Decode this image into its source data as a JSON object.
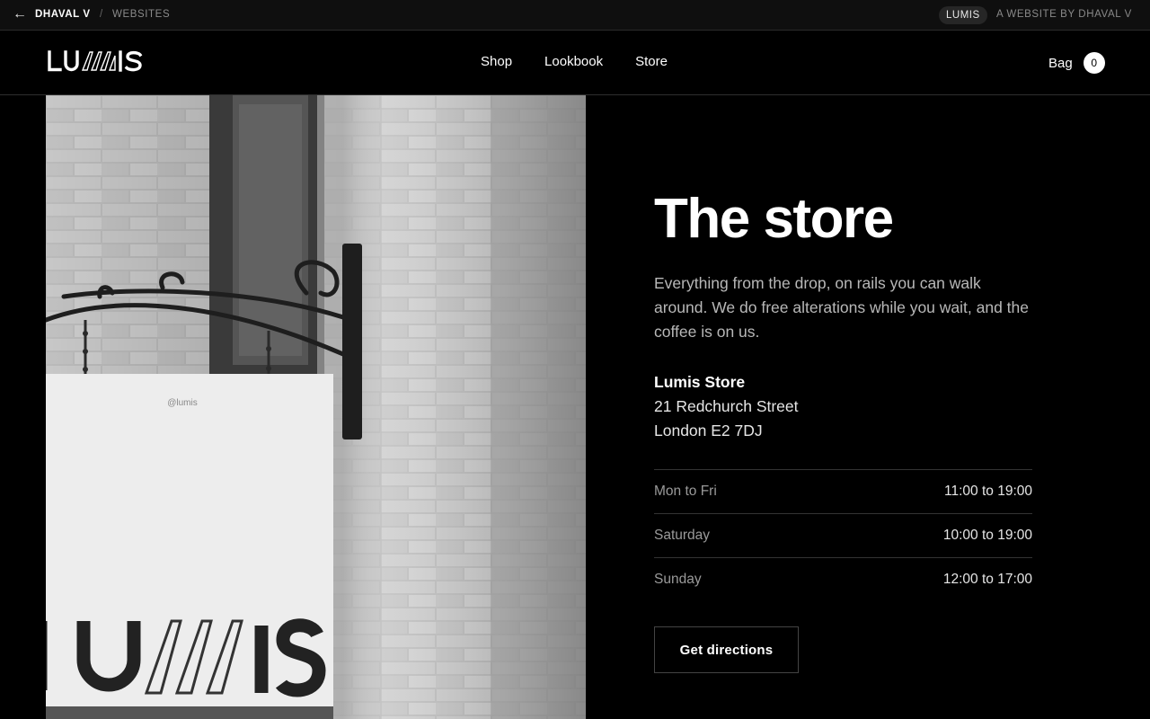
{
  "topbar": {
    "back_icon": "←",
    "owner": "DHAVAL V",
    "separator": "/",
    "section": "WEBSITES",
    "site_pill": "LUMIS",
    "credit": "A WEBSITE BY DHAVAL V"
  },
  "header": {
    "logo_text": "LUMIS",
    "nav": [
      "Shop",
      "Lookbook",
      "Store"
    ],
    "bag_label": "Bag",
    "bag_count": "0"
  },
  "photo": {
    "sign_handle": "@lumis",
    "sign_text": "LUMIS"
  },
  "main": {
    "title": "The store",
    "intro": "Everything from the drop, on rails you can walk around. We do free alterations while you wait, and the coffee is on us.",
    "store_name": "Lumis Store",
    "address_line1": "21 Redchurch Street",
    "address_line2": "London E2 7DJ",
    "hours": [
      {
        "day": "Mon to Fri",
        "time": "11:00 to 19:00"
      },
      {
        "day": "Saturday",
        "time": "10:00 to 19:00"
      },
      {
        "day": "Sunday",
        "time": "12:00 to 17:00"
      }
    ],
    "cta_label": "Get directions"
  },
  "colors": {
    "background": "#000000",
    "topbar": "#0f0f0f",
    "muted_text": "#b8b8b8",
    "divider": "#333333"
  }
}
